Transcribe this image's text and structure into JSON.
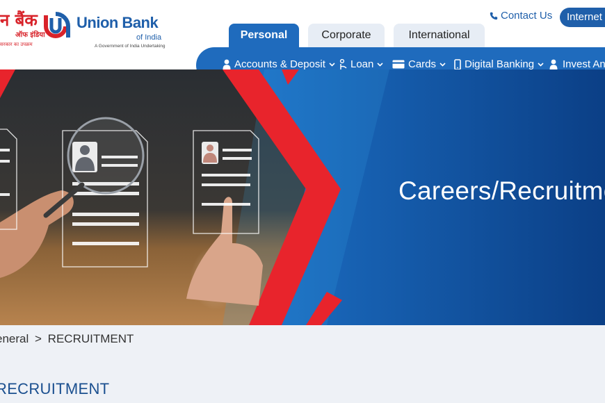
{
  "brand": {
    "hindi_line1": "न बैंक",
    "hindi_line2": "ऑफ इंडिया",
    "hindi_tagline": "सरकार का उपक्रम",
    "name": "Union Bank",
    "name_sub": "of India",
    "tagline": "A Government of India Undertaking",
    "colors": {
      "blue": "#1f5faa",
      "red": "#d8232a"
    }
  },
  "header": {
    "contact_label": "Contact Us",
    "contact_icon": "phone-icon",
    "internet_banking_label": "Internet B"
  },
  "tabs": [
    {
      "label": "Personal",
      "active": true
    },
    {
      "label": "Corporate",
      "active": false
    },
    {
      "label": "International",
      "active": false
    }
  ],
  "nav": [
    {
      "label": "Accounts & Deposit",
      "icon": "user-icon"
    },
    {
      "label": "Loan",
      "icon": "hand-coin-icon"
    },
    {
      "label": "Cards",
      "icon": "card-icon"
    },
    {
      "label": "Digital Banking",
      "icon": "mobile-icon"
    },
    {
      "label": "Invest And",
      "icon": "user-icon"
    }
  ],
  "banner": {
    "title": "Careers/Recruitme",
    "colors": {
      "blue_dark": "#0b3f86",
      "blue_light": "#2f9be0",
      "red": "#e8242c"
    }
  },
  "breadcrumb": {
    "parent": "eneral",
    "separator": ">",
    "current": "RECRUITMENT"
  },
  "page": {
    "heading": "RECRUITMENT"
  }
}
